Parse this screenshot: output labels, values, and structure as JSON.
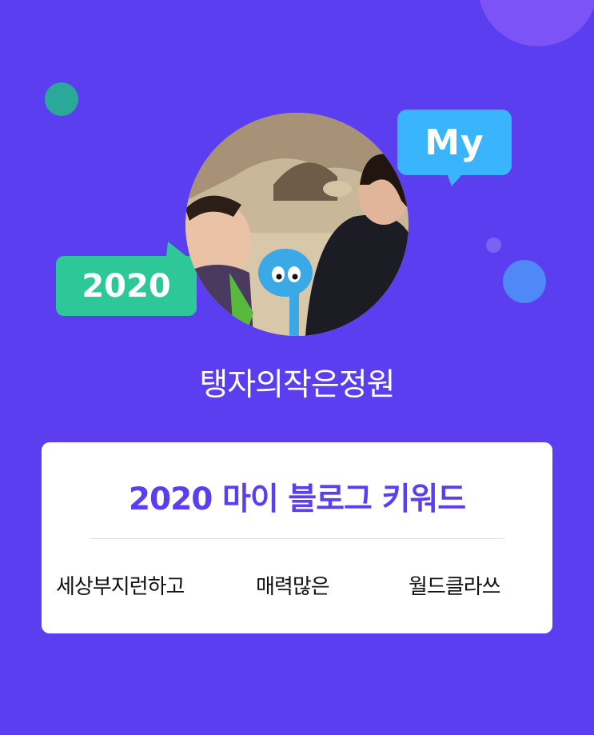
{
  "decor": {
    "badge_my": "My",
    "badge_year": "2020"
  },
  "profile": {
    "avatar_icon": "profile-photo",
    "blog_name": "탱자의작은정원"
  },
  "card": {
    "title": "2020 마이 블로그 키워드",
    "keywords": [
      "세상부지런하고",
      "매력많은",
      "월드클라쓰"
    ]
  },
  "colors": {
    "background": "#5b3ef0",
    "title": "#5b3ef0",
    "badge_my": "#3ab4fd",
    "badge_year": "#2ec898"
  }
}
